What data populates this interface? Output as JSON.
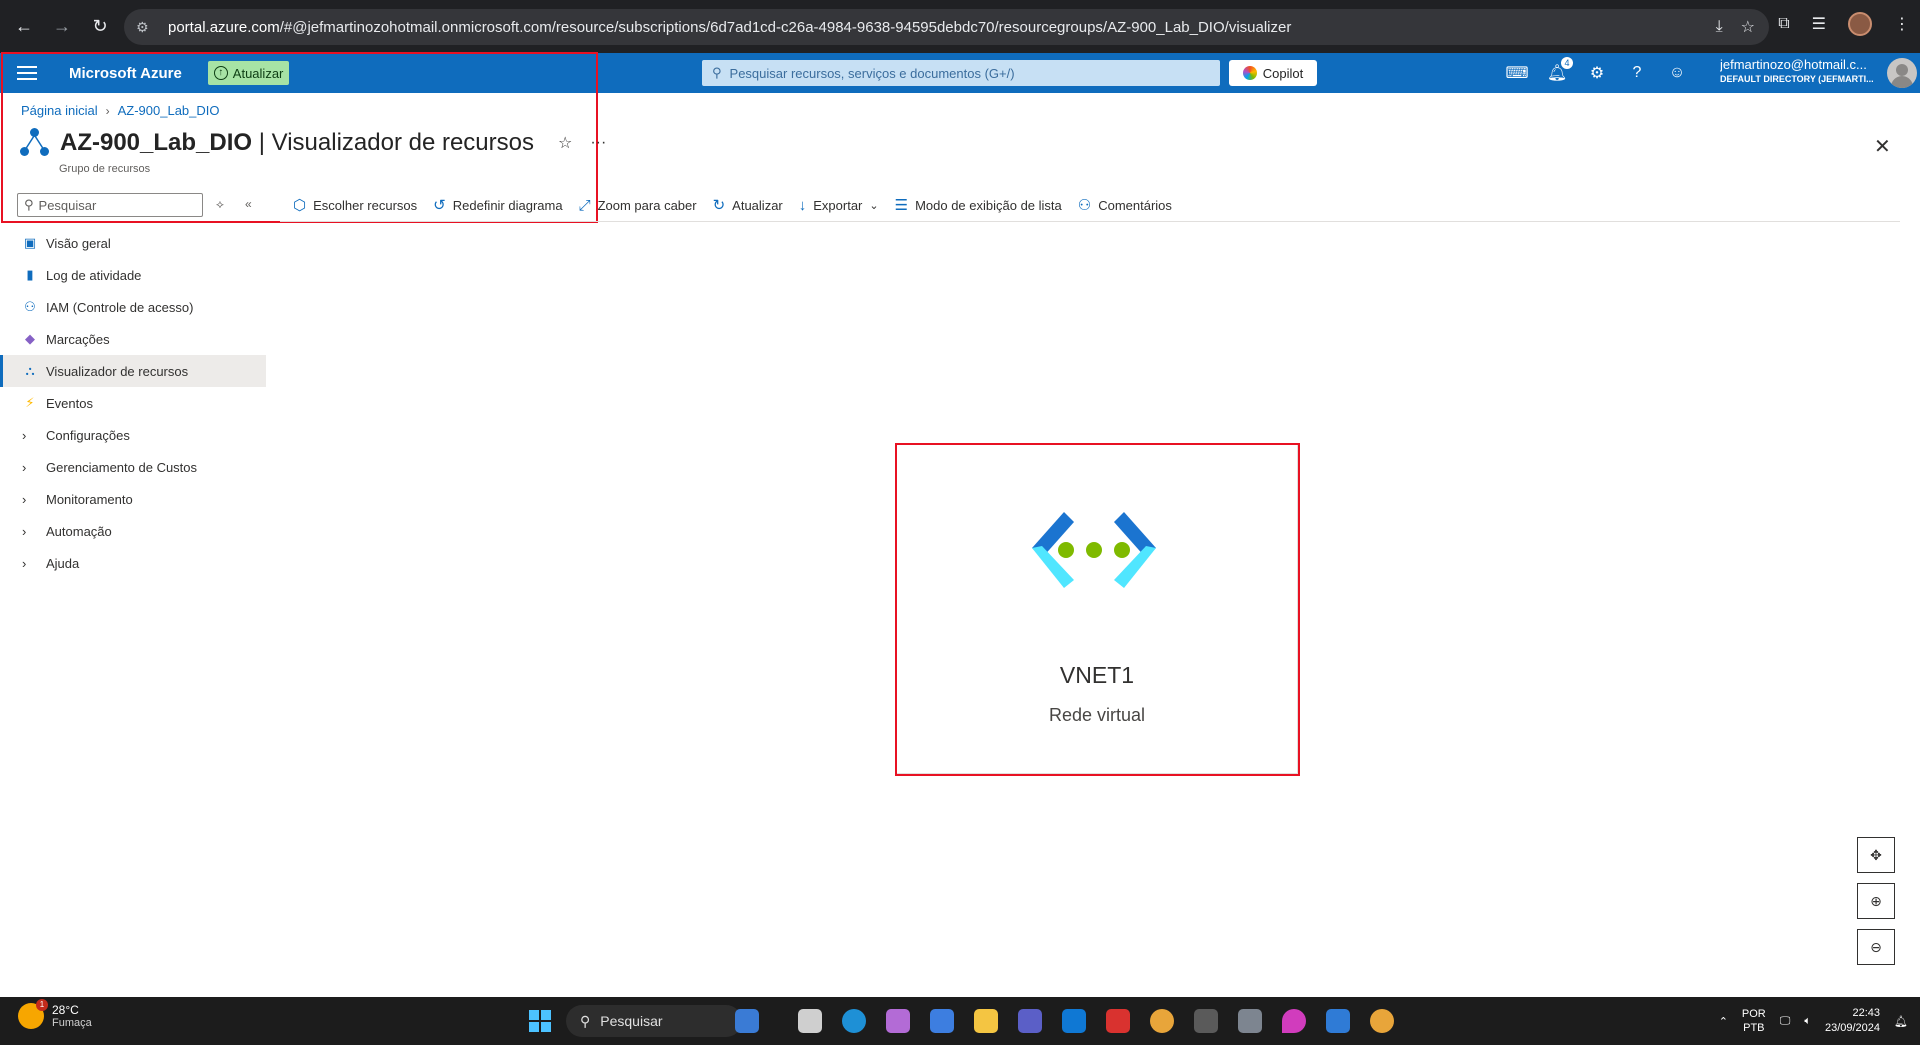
{
  "browser": {
    "url_host": "portal.azure.com",
    "url_path": "/#@jefmartinozohotmail.onmicrosoft.com/resource/subscriptions/6d7ad1cd-c26a-4984-9638-94595debdc70/resourcegroups/AZ-900_Lab_DIO/visualizer"
  },
  "header": {
    "brand": "Microsoft Azure",
    "update_label": "Atualizar",
    "search_placeholder": "Pesquisar recursos, serviços e documentos (G+/)",
    "copilot_label": "Copilot",
    "notifications_count": "4",
    "account_email": "jefmartinozo@hotmail.c...",
    "account_directory": "DEFAULT DIRECTORY (JEFMARTI..."
  },
  "breadcrumb": {
    "home": "Página inicial",
    "current": "AZ-900_Lab_DIO"
  },
  "page": {
    "title_bold": "AZ-900_Lab_DIO",
    "title_rest": " | Visualizador de recursos",
    "subtitle": "Grupo de recursos",
    "search_placeholder": "Pesquisar"
  },
  "toolbar": [
    {
      "label": "Escolher recursos",
      "icon": "cube-icon"
    },
    {
      "label": "Redefinir diagrama",
      "icon": "reset-icon"
    },
    {
      "label": "Zoom para caber",
      "icon": "zoom-fit-icon"
    },
    {
      "label": "Atualizar",
      "icon": "refresh-icon"
    },
    {
      "label": "Exportar",
      "icon": "download-icon"
    },
    {
      "label": "Modo de exibição de lista",
      "icon": "list-icon"
    },
    {
      "label": "Comentários",
      "icon": "feedback-icon"
    }
  ],
  "sidebar": {
    "items": [
      {
        "label": "Visão geral",
        "icon": "overview-icon"
      },
      {
        "label": "Log de atividade",
        "icon": "activity-log-icon"
      },
      {
        "label": "IAM (Controle de acesso)",
        "icon": "iam-icon"
      },
      {
        "label": "Marcações",
        "icon": "tag-icon"
      },
      {
        "label": "Visualizador de recursos",
        "icon": "visualizer-icon",
        "active": true
      },
      {
        "label": "Eventos",
        "icon": "events-icon"
      },
      {
        "label": "Configurações",
        "expandable": true
      },
      {
        "label": "Gerenciamento de Custos",
        "expandable": true
      },
      {
        "label": "Monitoramento",
        "expandable": true
      },
      {
        "label": "Automação",
        "expandable": true
      },
      {
        "label": "Ajuda",
        "expandable": true
      }
    ]
  },
  "canvas": {
    "resource_name": "VNET1",
    "resource_type": "Rede virtual"
  },
  "taskbar": {
    "temperature": "28°C",
    "weather": "Fumaça",
    "weather_badge": "1",
    "search_label": "Pesquisar",
    "lang_top": "POR",
    "lang_bottom": "PTB",
    "time": "22:43",
    "date": "23/09/2024"
  },
  "colors": {
    "azure_blue": "#0f6cbd",
    "highlight_red": "#e81123",
    "vnet_dark": "#1b74d0",
    "vnet_light": "#50e6ff",
    "vnet_dots": "#7fba00"
  }
}
